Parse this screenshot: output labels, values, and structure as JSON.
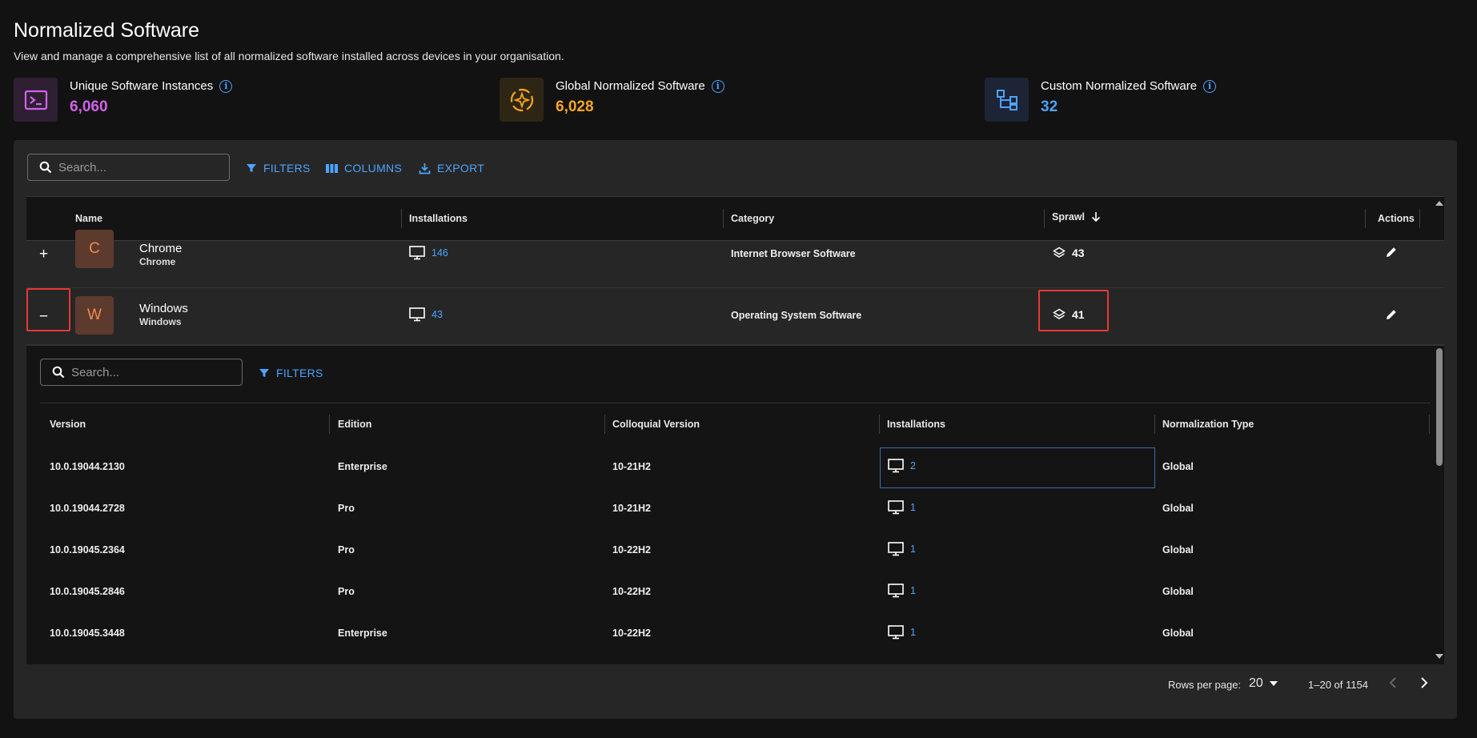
{
  "page": {
    "title": "Normalized Software",
    "subtitle": "View and manage a comprehensive list of all normalized software installed across devices in your organisation."
  },
  "stats": [
    {
      "label": "Unique Software Instances",
      "value": "6,060",
      "icon": "terminal-icon",
      "color": "#d163e8"
    },
    {
      "label": "Global Normalized Software",
      "value": "6,028",
      "icon": "sparkle-sync-icon",
      "color": "#f5a623"
    },
    {
      "label": "Custom Normalized Software",
      "value": "32",
      "icon": "hierarchy-icon",
      "color": "#4da3ff"
    }
  ],
  "toolbar": {
    "search_placeholder": "Search...",
    "filters": "FILTERS",
    "columns": "COLUMNS",
    "export": "EXPORT"
  },
  "table": {
    "headers": {
      "name": "Name",
      "installations": "Installations",
      "category": "Category",
      "sprawl": "Sprawl",
      "actions": "Actions"
    },
    "rows": [
      {
        "expander": "+",
        "avatar": "C",
        "name": "Chrome",
        "publisher": "Chrome",
        "installations": "146",
        "category": "Internet Browser Software",
        "sprawl": "43"
      },
      {
        "expander": "−",
        "avatar": "W",
        "name": "Windows",
        "publisher": "Windows",
        "installations": "43",
        "category": "Operating System Software",
        "sprawl": "41"
      }
    ]
  },
  "subtable": {
    "search_placeholder": "Search...",
    "filters": "FILTERS",
    "headers": {
      "version": "Version",
      "edition": "Edition",
      "colloquial": "Colloquial Version",
      "installations": "Installations",
      "normalization": "Normalization Type"
    },
    "rows": [
      {
        "version": "10.0.19044.2130",
        "edition": "Enterprise",
        "colloquial": "10-21H2",
        "installations": "2",
        "normalization": "Global"
      },
      {
        "version": "10.0.19044.2728",
        "edition": "Pro",
        "colloquial": "10-21H2",
        "installations": "1",
        "normalization": "Global"
      },
      {
        "version": "10.0.19045.2364",
        "edition": "Pro",
        "colloquial": "10-22H2",
        "installations": "1",
        "normalization": "Global"
      },
      {
        "version": "10.0.19045.2846",
        "edition": "Pro",
        "colloquial": "10-22H2",
        "installations": "1",
        "normalization": "Global"
      },
      {
        "version": "10.0.19045.3448",
        "edition": "Enterprise",
        "colloquial": "10-22H2",
        "installations": "1",
        "normalization": "Global"
      }
    ]
  },
  "pagination": {
    "rows_per_page_label": "Rows per page:",
    "rows_per_page": "20",
    "range": "1–20 of 1154"
  }
}
